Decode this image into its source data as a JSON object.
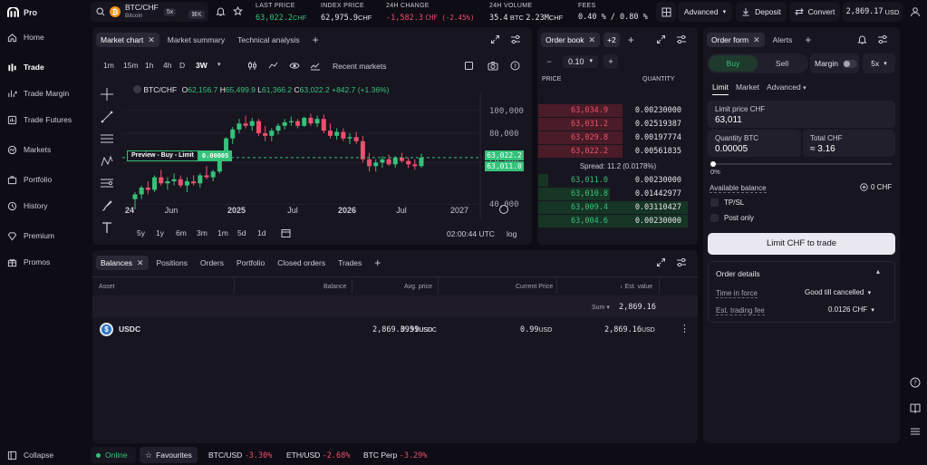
{
  "app": {
    "name": "Pro"
  },
  "sidebar": {
    "items": [
      {
        "label": "Home"
      },
      {
        "label": "Trade"
      },
      {
        "label": "Trade Margin"
      },
      {
        "label": "Trade Futures"
      },
      {
        "label": "Markets"
      },
      {
        "label": "Portfolio"
      },
      {
        "label": "History"
      },
      {
        "label": "Premium"
      },
      {
        "label": "Promos"
      }
    ],
    "collapse_label": "Collapse"
  },
  "topbar": {
    "pair": "BTC/CHF",
    "pair_name": "Bitcoin",
    "leverage": "5x",
    "shortcut": "⌘K",
    "stats": [
      {
        "label": "LAST PRICE",
        "value": "63,022.2",
        "unit": "CHF"
      },
      {
        "label": "INDEX PRICE",
        "value": "62,975.9",
        "unit": "CHF"
      },
      {
        "label": "24H CHANGE",
        "value": "-1,582.3",
        "unit": "CHF (-2.45%)"
      },
      {
        "label": "24H VOLUME",
        "value": "35.4",
        "unit": "BTC",
        "value2": "2.23M",
        "unit2": "CHF"
      },
      {
        "label": "FEES",
        "value": "0.40 % / 0.80 %"
      }
    ],
    "mode": "Advanced",
    "deposit": "Deposit",
    "convert": "Convert",
    "balance": "2,869.17",
    "balance_unit": "USD"
  },
  "chart_panel": {
    "tabs": [
      "Market chart",
      "Market summary",
      "Technical analysis"
    ],
    "timeframes": [
      "1m",
      "15m",
      "1h",
      "4h",
      "D",
      "3W"
    ],
    "recent_markets": "Recent markets",
    "ohlc": {
      "pair": "BTC/CHF",
      "o_label": "O",
      "o": "62,156.7",
      "h_label": "H",
      "h": "65,499.9",
      "l_label": "L",
      "l": "61,366.2",
      "c_label": "C",
      "c": "63,022.2",
      "change": "+842.7 (+1.36%)"
    },
    "preview_label": "Preview - Buy - Limit",
    "preview_qty": "0.00005",
    "price_tag_1": "63,022.2",
    "price_tag_2": "63,011.0",
    "ranges": [
      "5y",
      "1y",
      "6m",
      "3m",
      "1m",
      "5d",
      "1d"
    ],
    "time": "02:00:44 UTC",
    "scale": "log"
  },
  "chart_data": {
    "type": "candlestick",
    "y_ticks": [
      40000,
      60000,
      80000,
      100000
    ],
    "y_tick_labels": [
      "40,000",
      "60,000",
      "80,000",
      "100,000"
    ],
    "x_ticks": [
      "24",
      "Jun",
      "2025",
      "Jul",
      "2026",
      "Jul",
      "2027"
    ],
    "scale": "log",
    "last_price": 63022.2,
    "preview_price": 63011.0,
    "candles": [
      {
        "o": 42000,
        "h": 45000,
        "l": 38000,
        "c": 44000
      },
      {
        "o": 44000,
        "h": 48000,
        "l": 42000,
        "c": 47000
      },
      {
        "o": 47000,
        "h": 50000,
        "l": 44000,
        "c": 46000
      },
      {
        "o": 46000,
        "h": 53000,
        "l": 45000,
        "c": 52000
      },
      {
        "o": 52000,
        "h": 56000,
        "l": 48000,
        "c": 49000
      },
      {
        "o": 49000,
        "h": 52000,
        "l": 46000,
        "c": 50000
      },
      {
        "o": 50000,
        "h": 54000,
        "l": 48000,
        "c": 51000
      },
      {
        "o": 51000,
        "h": 53000,
        "l": 47000,
        "c": 48000
      },
      {
        "o": 48000,
        "h": 52000,
        "l": 45000,
        "c": 50000
      },
      {
        "o": 50000,
        "h": 53000,
        "l": 48000,
        "c": 49000
      },
      {
        "o": 49000,
        "h": 54000,
        "l": 47000,
        "c": 53000
      },
      {
        "o": 53000,
        "h": 58000,
        "l": 51000,
        "c": 52000
      },
      {
        "o": 52000,
        "h": 56000,
        "l": 50000,
        "c": 55000
      },
      {
        "o": 55000,
        "h": 66000,
        "l": 54000,
        "c": 65000
      },
      {
        "o": 65000,
        "h": 77000,
        "l": 63000,
        "c": 76000
      },
      {
        "o": 76000,
        "h": 85000,
        "l": 72000,
        "c": 83000
      },
      {
        "o": 83000,
        "h": 92000,
        "l": 80000,
        "c": 88000
      },
      {
        "o": 88000,
        "h": 95000,
        "l": 84000,
        "c": 86000
      },
      {
        "o": 86000,
        "h": 93000,
        "l": 82000,
        "c": 90000
      },
      {
        "o": 90000,
        "h": 92000,
        "l": 78000,
        "c": 80000
      },
      {
        "o": 80000,
        "h": 86000,
        "l": 74000,
        "c": 78000
      },
      {
        "o": 78000,
        "h": 84000,
        "l": 74000,
        "c": 82000
      },
      {
        "o": 82000,
        "h": 88000,
        "l": 79000,
        "c": 86000
      },
      {
        "o": 86000,
        "h": 92000,
        "l": 83000,
        "c": 89000
      },
      {
        "o": 89000,
        "h": 94000,
        "l": 86000,
        "c": 90000
      },
      {
        "o": 90000,
        "h": 92000,
        "l": 84000,
        "c": 86000
      },
      {
        "o": 86000,
        "h": 94000,
        "l": 85000,
        "c": 93000
      },
      {
        "o": 93000,
        "h": 97000,
        "l": 86000,
        "c": 88000
      },
      {
        "o": 88000,
        "h": 95000,
        "l": 85000,
        "c": 92000
      },
      {
        "o": 92000,
        "h": 96000,
        "l": 80000,
        "c": 82000
      },
      {
        "o": 82000,
        "h": 88000,
        "l": 76000,
        "c": 78000
      },
      {
        "o": 78000,
        "h": 84000,
        "l": 75000,
        "c": 81000
      },
      {
        "o": 81000,
        "h": 84000,
        "l": 74000,
        "c": 76000
      },
      {
        "o": 76000,
        "h": 80000,
        "l": 72000,
        "c": 77000
      },
      {
        "o": 77000,
        "h": 81000,
        "l": 72000,
        "c": 74000
      },
      {
        "o": 74000,
        "h": 78000,
        "l": 60000,
        "c": 62000
      },
      {
        "o": 62000,
        "h": 66000,
        "l": 55000,
        "c": 58000
      },
      {
        "o": 58000,
        "h": 62000,
        "l": 55000,
        "c": 60000
      },
      {
        "o": 60000,
        "h": 64000,
        "l": 57000,
        "c": 62000
      },
      {
        "o": 62000,
        "h": 65000,
        "l": 58000,
        "c": 59000
      },
      {
        "o": 59000,
        "h": 64000,
        "l": 57000,
        "c": 63000
      },
      {
        "o": 63000,
        "h": 66000,
        "l": 60000,
        "c": 61000
      },
      {
        "o": 61000,
        "h": 63000,
        "l": 57000,
        "c": 59000
      },
      {
        "o": 59000,
        "h": 62000,
        "l": 56000,
        "c": 58000
      },
      {
        "o": 58000,
        "h": 65500,
        "l": 57000,
        "c": 63022
      }
    ]
  },
  "orderbook": {
    "tabs": [
      "Order book",
      "+2"
    ],
    "tick": "0.10",
    "header_price": "PRICE",
    "header_qty": "QUANTITY",
    "asks": [
      {
        "price": "63,034.9",
        "qty": "0.00230000",
        "depth": 0.53
      },
      {
        "price": "63,031.2",
        "qty": "0.02519387",
        "depth": 0.53
      },
      {
        "price": "63,029.8",
        "qty": "0.00197774",
        "depth": 0.53
      },
      {
        "price": "63,022.2",
        "qty": "0.00561835",
        "depth": 0.53
      }
    ],
    "spread": "Spread: 11.2 (0.0178%)",
    "bids": [
      {
        "price": "63,011.0",
        "qty": "0.00230000",
        "depth": 0.06
      },
      {
        "price": "63,010.8",
        "qty": "0.01442977",
        "depth": 0.45
      },
      {
        "price": "63,009.4",
        "qty": "0.03110427",
        "depth": 0.94
      },
      {
        "price": "63,004.6",
        "qty": "0.00230000",
        "depth": 0.94
      }
    ]
  },
  "order_form": {
    "tabs": [
      "Order form",
      "Alerts"
    ],
    "buy": "Buy",
    "sell": "Sell",
    "margin": "Margin",
    "leverage": "5x",
    "types": [
      "Limit",
      "Market",
      "Advanced"
    ],
    "limit_label": "Limit price CHF",
    "limit_value": "63,011",
    "qty_label": "Quantity BTC",
    "qty_value": "0.00005",
    "total_label": "Total CHF",
    "total_value": "≈  3.16",
    "slider_pct": "0%",
    "available_label": "Available balance",
    "available_value": "0 CHF",
    "tpsl": "TP/SL",
    "post_only": "Post only",
    "submit": "Limit CHF to trade",
    "details_title": "Order details",
    "tif_label": "Time in force",
    "tif_value": "Good till cancelled",
    "fee_label": "Est. trading fee",
    "fee_value": "0.0126 CHF"
  },
  "bottom": {
    "tabs": [
      "Balances",
      "Positions",
      "Orders",
      "Portfolio",
      "Closed orders",
      "Trades"
    ],
    "headers": [
      "Asset",
      "Balance",
      "Avg. price",
      "Current Price",
      "Est. value"
    ],
    "sum_label": "Sum",
    "sum_value": "2,869.16",
    "rows": [
      {
        "asset": "USDC",
        "balance": "2,869.3951",
        "balance_unit": "USDC",
        "avg": "0.99",
        "avg_unit": "USD",
        "cur": "0.99",
        "cur_unit": "USD",
        "value": "2,869.16",
        "value_unit": "USD"
      }
    ]
  },
  "statusbar": {
    "online": "Online",
    "favourites": "Favourites",
    "tickers": [
      {
        "name": "BTC/USD",
        "change": "-3.30%"
      },
      {
        "name": "ETH/USD",
        "change": "-2.68%"
      },
      {
        "name": "BTC Perp",
        "change": "-3.29%"
      }
    ]
  }
}
